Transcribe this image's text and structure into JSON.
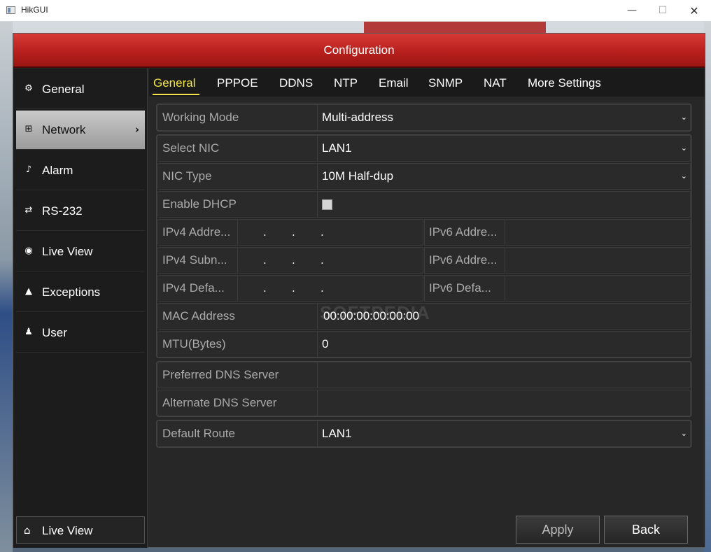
{
  "window": {
    "title": "HikGUI",
    "minimize": "—",
    "maximize": "☐",
    "close": "✕"
  },
  "dialog": {
    "title": "Configuration"
  },
  "sidebar": {
    "items": [
      {
        "label": "General",
        "icon": "⚙"
      },
      {
        "label": "Network",
        "icon": "⊞",
        "chevron": "›"
      },
      {
        "label": "Alarm",
        "icon": "♪"
      },
      {
        "label": "RS-232",
        "icon": "⇄"
      },
      {
        "label": "Live View",
        "icon": "◉"
      },
      {
        "label": "Exceptions",
        "icon": "▲"
      },
      {
        "label": "User",
        "icon": "♟"
      }
    ],
    "bottom": {
      "label": "Live View",
      "icon": "⌂"
    }
  },
  "tabs": [
    "General",
    "PPPOE",
    "DDNS",
    "NTP",
    "Email",
    "SNMP",
    "NAT",
    "More Settings"
  ],
  "form": {
    "working_mode": {
      "label": "Working Mode",
      "value": "Multi-address"
    },
    "select_nic": {
      "label": "Select NIC",
      "value": "LAN1"
    },
    "nic_type": {
      "label": "NIC Type",
      "value": "10M Half-dup"
    },
    "enable_dhcp": {
      "label": "Enable DHCP",
      "checked": false
    },
    "ipv4_address": {
      "label": "IPv4 Addre..."
    },
    "ipv4_subnet": {
      "label": "IPv4 Subn..."
    },
    "ipv4_default": {
      "label": "IPv4 Defa..."
    },
    "ipv6_address1": {
      "label": "IPv6 Addre..."
    },
    "ipv6_address2": {
      "label": "IPv6 Addre..."
    },
    "ipv6_default": {
      "label": "IPv6 Defa..."
    },
    "ip_dot": ".",
    "mac_address": {
      "label": "MAC Address",
      "value": "00:00:00:00:00:00"
    },
    "mtu": {
      "label": "MTU(Bytes)",
      "value": "0"
    },
    "preferred_dns": {
      "label": "Preferred DNS Server",
      "value": ""
    },
    "alternate_dns": {
      "label": "Alternate DNS Server",
      "value": ""
    },
    "default_route": {
      "label": "Default Route",
      "value": "LAN1"
    },
    "caret": "⌄"
  },
  "watermark": "SOFTPEDIA",
  "buttons": {
    "apply": "Apply",
    "back": "Back"
  }
}
